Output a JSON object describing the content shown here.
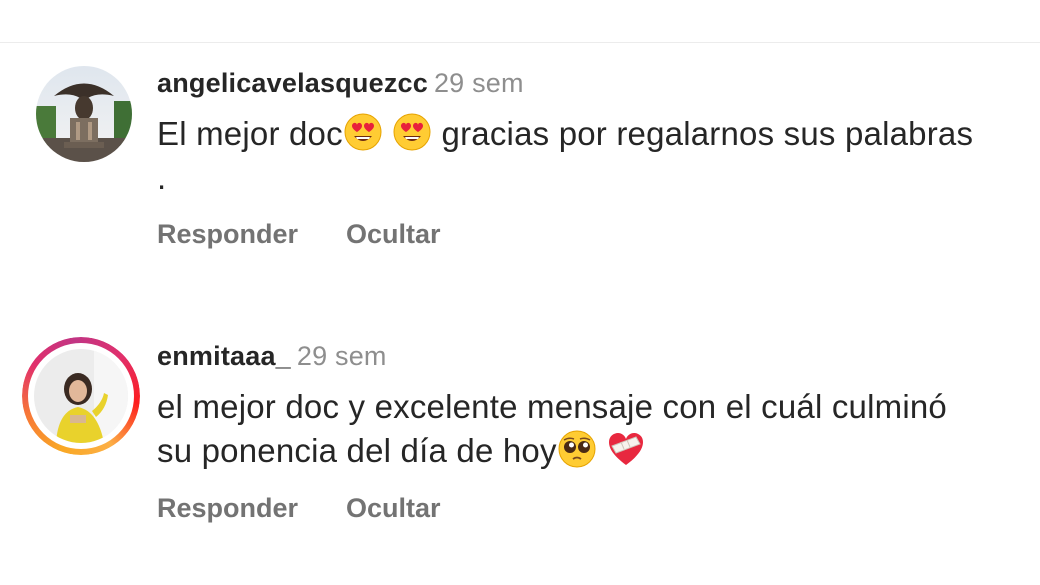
{
  "comments": [
    {
      "username": "angelicavelasquezcc",
      "time": "29 sem",
      "text_before": "El mejor doc",
      "text_after": " gracias por regalarnos sus palabras .",
      "emojis": [
        "heart-eyes-emoji",
        "heart-eyes-emoji"
      ],
      "reply_label": "Responder",
      "hide_label": "Ocultar"
    },
    {
      "username": "enmitaaa_",
      "time": "29 sem",
      "text_before": "el mejor doc y excelente mensaje con el cuál culminó su ponencia del día de hoy",
      "text_after": "",
      "emojis": [
        "pleading-face-emoji",
        "mending-heart-emoji"
      ],
      "has_story_ring": true,
      "reply_label": "Responder",
      "hide_label": "Ocultar"
    }
  ],
  "colors": {
    "text": "#262626",
    "secondary": "#8e8e8e",
    "action": "#737373"
  }
}
